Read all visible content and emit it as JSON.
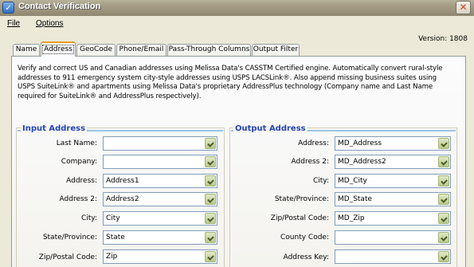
{
  "window": {
    "title": "Contact Verification",
    "version": "Version: 1808"
  },
  "menu": [
    {
      "label": "File"
    },
    {
      "label": "Options"
    }
  ],
  "tabs": [
    {
      "label": "Name"
    },
    {
      "label": "Address"
    },
    {
      "label": "GeoCode"
    },
    {
      "label": "Phone/Email"
    },
    {
      "label": "Pass-Through Columns"
    },
    {
      "label": "Output Filter"
    }
  ],
  "active_tab": "Address",
  "description": {
    "line1": "Verify and correct US and Canadian addresses using Melissa Data's CASSTM Certified engine. Automatically convert rural-style",
    "line2": "addresses to 911 emergency system city-style addresses using USPS LACSLink®. Also append missing business suites using",
    "line3": "USPS SuiteLink® and apartments using Melissa Data's proprietary AddressPlus technology (Company name and Last Name",
    "line4": "required for SuiteLink® and AddressPlus respectively)."
  },
  "input_address": {
    "title": "Input Address",
    "fields": [
      {
        "label": "Last Name:",
        "value": ""
      },
      {
        "label": "Company:",
        "value": ""
      },
      {
        "label": "Address:",
        "value": "Address1"
      },
      {
        "label": "Address 2:",
        "value": "Address2"
      },
      {
        "label": "City:",
        "value": "City"
      },
      {
        "label": "State/Province:",
        "value": "State"
      },
      {
        "label": "Zip/Postal Code:",
        "value": "Zip"
      }
    ]
  },
  "output_address": {
    "title": "Output Address",
    "fields": [
      {
        "label": "Address:",
        "value": "MD_Address"
      },
      {
        "label": "Address 2:",
        "value": "MD_Address2"
      },
      {
        "label": "City:",
        "value": "MD_City"
      },
      {
        "label": "State/Province:",
        "value": "MD_State"
      },
      {
        "label": "Zip/Postal Code:",
        "value": "MD_Zip"
      },
      {
        "label": "County Code:",
        "value": ""
      },
      {
        "label": "Address Key:",
        "value": ""
      }
    ]
  },
  "colors": {
    "group_title": "#2346b8",
    "active_tab_accent": "#e6a020",
    "combo_button": "#b8c98c"
  }
}
